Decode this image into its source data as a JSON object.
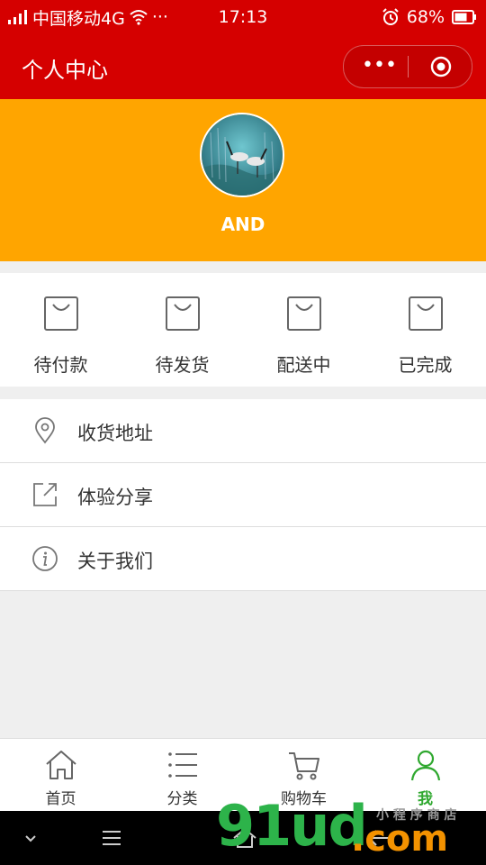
{
  "status_bar": {
    "carrier": "中国移动4G",
    "dots": "···",
    "time": "17:13",
    "battery": "68%"
  },
  "nav": {
    "title": "个人中心",
    "more": "•••"
  },
  "profile": {
    "username": "AND"
  },
  "orders": [
    {
      "label": "待付款"
    },
    {
      "label": "待发货"
    },
    {
      "label": "配送中"
    },
    {
      "label": "已完成"
    }
  ],
  "menu": [
    {
      "label": "收货地址",
      "icon": "location-icon"
    },
    {
      "label": "体验分享",
      "icon": "share-icon"
    },
    {
      "label": "关于我们",
      "icon": "info-icon"
    }
  ],
  "tabs": [
    {
      "label": "首页",
      "icon": "home-icon"
    },
    {
      "label": "分类",
      "icon": "list-icon"
    },
    {
      "label": "购物车",
      "icon": "cart-icon"
    },
    {
      "label": "我",
      "icon": "user-icon",
      "active": true
    }
  ],
  "watermark": {
    "brand": "91ud",
    "suffix": ".com",
    "tagline": "小 程 序 商 店"
  },
  "colors": {
    "header": "#d50000",
    "profile_bg": "#ffa500",
    "active_tab": "#2fa82f"
  }
}
